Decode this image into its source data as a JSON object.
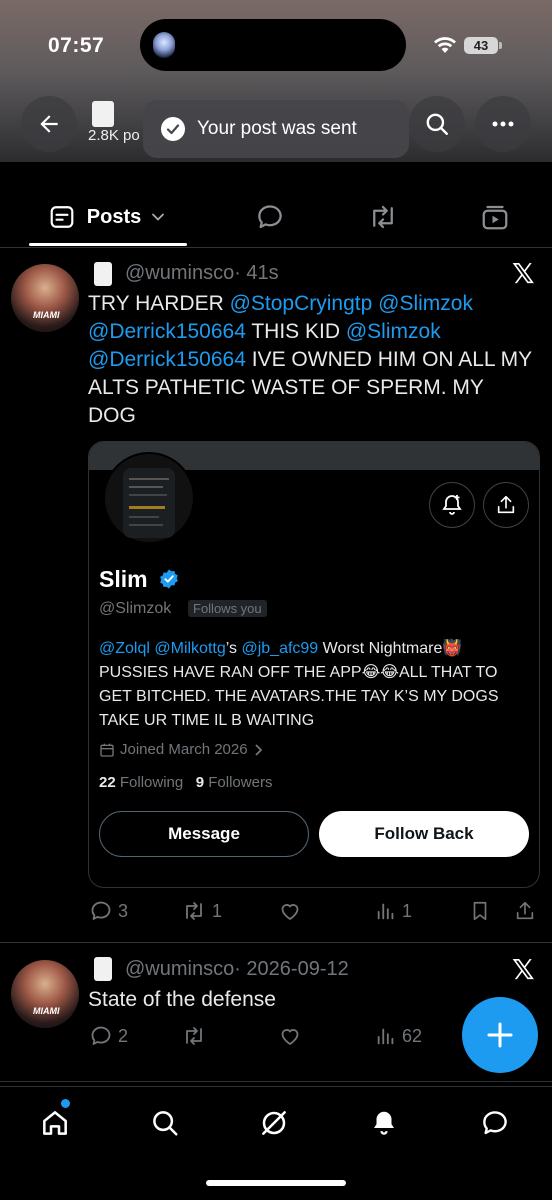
{
  "status_bar": {
    "time": "07:57",
    "battery": "43"
  },
  "header": {
    "followers_stub": "2.8K po"
  },
  "toast": {
    "message": "Your post was sent"
  },
  "tabs": {
    "posts_label": "Posts"
  },
  "post1": {
    "handle": "@wuminsco",
    "age": "· 41s",
    "text_parts": [
      "TRY HARDER ",
      "@StopCryingtp",
      " ",
      "@Slimzok",
      "@Derrick150664",
      " THIS KID ",
      "@Slimzok",
      "@Derrick150664",
      " IVE OWNED HIM ON ALL MY ALTS PATHETIC WASTE OF SPERM. MY DOG"
    ],
    "replies": "3",
    "reposts": "1",
    "views": "1"
  },
  "card": {
    "name": "Slim",
    "handle": "@Slimzok",
    "follows_you": "Follows you",
    "bio_mentions": [
      "@Zolql",
      "@Milkottg",
      "@jb_afc99"
    ],
    "bio_possessive": "’s ",
    "bio_text": " Worst Nightmare👹 PUSSIES HAVE RAN OFF THE APP😂😂ALL THAT TO GET BITCHED. THE AVATARS.THE TAY K’S MY DOGS TAKE UR TIME IL B WAITING",
    "joined": "Joined March 2026",
    "following_count": "22",
    "following_label": "Following",
    "followers_count": "9",
    "followers_label": "Followers",
    "message_label": "Message",
    "follow_back_label": "Follow Back"
  },
  "post2": {
    "handle": "@wuminsco",
    "age": "· 2026-09-12",
    "text": "State of the defense",
    "replies": "2",
    "views": "62"
  },
  "avatar_tag": "MIAMI",
  "colors": {
    "accent": "#1d9bf0",
    "background": "#000000",
    "muted": "#71767b"
  },
  "icons": [
    "back-arrow-icon",
    "search-icon",
    "more-icon",
    "chevron-down-icon",
    "reply-icon",
    "repost-icon",
    "like-icon",
    "views-icon",
    "bookmark-icon",
    "share-icon",
    "x-logo-icon",
    "home-icon",
    "grok-icon",
    "bell-icon",
    "chat-icon",
    "plus-icon",
    "check-icon"
  ]
}
